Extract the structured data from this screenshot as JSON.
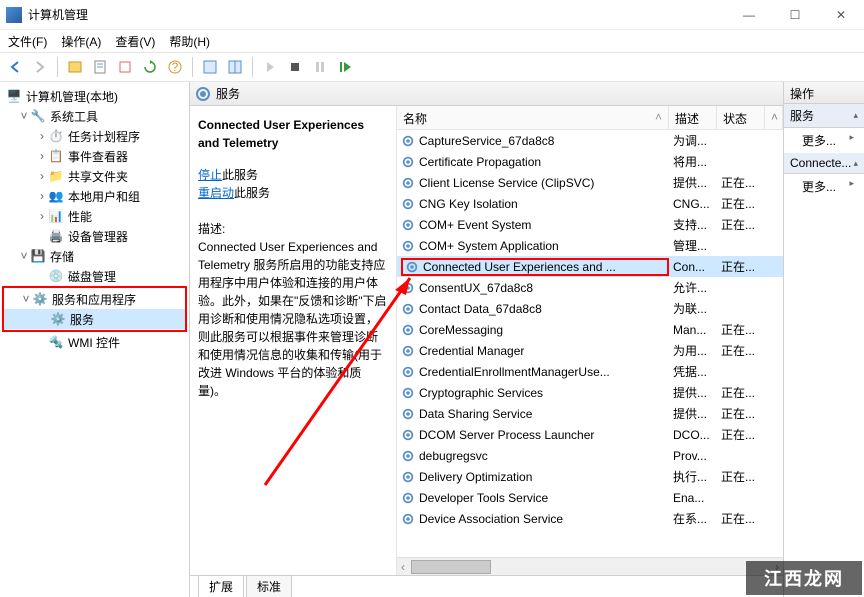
{
  "window": {
    "title": "计算机管理",
    "minimize": "—",
    "maximize": "☐",
    "close": "✕"
  },
  "menubar": {
    "file": "文件(F)",
    "action": "操作(A)",
    "view": "查看(V)",
    "help": "帮助(H)"
  },
  "tree": {
    "root": "计算机管理(本地)",
    "system_tools": "系统工具",
    "task_scheduler": "任务计划程序",
    "event_viewer": "事件查看器",
    "shared_folders": "共享文件夹",
    "local_users": "本地用户和组",
    "performance": "性能",
    "device_manager": "设备管理器",
    "storage": "存储",
    "disk_management": "磁盘管理",
    "services_apps": "服务和应用程序",
    "services": "服务",
    "wmi": "WMI 控件"
  },
  "center": {
    "header": "服务",
    "selected_title": "Connected User Experiences and Telemetry",
    "stop_link": "停止",
    "stop_suffix": "此服务",
    "restart_link": "重启动",
    "restart_suffix": "此服务",
    "desc_label": "描述:",
    "desc_text": "Connected User Experiences and Telemetry 服务所启用的功能支持应用程序中用户体验和连接的用户体验。此外，如果在\"反馈和诊断\"下启用诊断和使用情况隐私选项设置，则此服务可以根据事件来管理诊断和使用情况信息的收集和传输(用于改进 Windows 平台的体验和质量)。",
    "col_name": "名称",
    "col_desc": "描述",
    "col_stat": "状态",
    "tab_extended": "扩展",
    "tab_standard": "标准"
  },
  "services": [
    {
      "name": "CaptureService_67da8c8",
      "desc": "为调...",
      "stat": ""
    },
    {
      "name": "Certificate Propagation",
      "desc": "将用...",
      "stat": ""
    },
    {
      "name": "Client License Service (ClipSVC)",
      "desc": "提供...",
      "stat": "正在..."
    },
    {
      "name": "CNG Key Isolation",
      "desc": "CNG...",
      "stat": "正在..."
    },
    {
      "name": "COM+ Event System",
      "desc": "支持...",
      "stat": "正在..."
    },
    {
      "name": "COM+ System Application",
      "desc": "管理...",
      "stat": ""
    },
    {
      "name": "Connected User Experiences and ...",
      "desc": "Con...",
      "stat": "正在...",
      "selected": true
    },
    {
      "name": "ConsentUX_67da8c8",
      "desc": "允许...",
      "stat": ""
    },
    {
      "name": "Contact Data_67da8c8",
      "desc": "为联...",
      "stat": ""
    },
    {
      "name": "CoreMessaging",
      "desc": "Man...",
      "stat": "正在..."
    },
    {
      "name": "Credential Manager",
      "desc": "为用...",
      "stat": "正在..."
    },
    {
      "name": "CredentialEnrollmentManagerUse...",
      "desc": "凭据...",
      "stat": ""
    },
    {
      "name": "Cryptographic Services",
      "desc": "提供...",
      "stat": "正在..."
    },
    {
      "name": "Data Sharing Service",
      "desc": "提供...",
      "stat": "正在..."
    },
    {
      "name": "DCOM Server Process Launcher",
      "desc": "DCO...",
      "stat": "正在..."
    },
    {
      "name": "debugregsvc",
      "desc": "Prov...",
      "stat": ""
    },
    {
      "name": "Delivery Optimization",
      "desc": "执行...",
      "stat": "正在..."
    },
    {
      "name": "Developer Tools Service",
      "desc": "Ena...",
      "stat": ""
    },
    {
      "name": "Device Association Service",
      "desc": "在系...",
      "stat": "正在..."
    }
  ],
  "actions": {
    "header": "操作",
    "group1": "服务",
    "more1": "更多...",
    "group2": "Connecte...",
    "more2": "更多..."
  },
  "watermark": "江西龙网"
}
